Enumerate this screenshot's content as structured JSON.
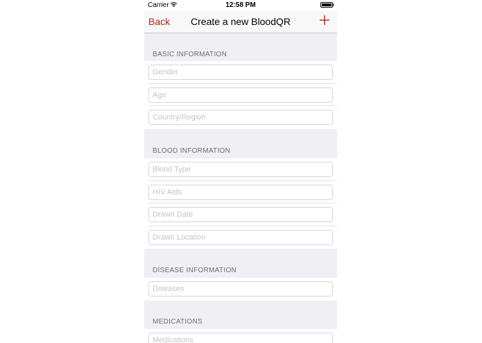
{
  "status_bar": {
    "carrier": "Carrier",
    "time": "12:58 PM"
  },
  "nav": {
    "back_label": "Back",
    "title": "Create a new BloodQR",
    "add_icon": "plus-icon"
  },
  "colors": {
    "accent": "#b4201d",
    "group_background": "#efeff4",
    "section_text": "#6d6d72"
  },
  "sections": {
    "basic": {
      "title": "BASIC INFORMATION",
      "fields": [
        "Gender",
        "Age",
        "Country/Region"
      ]
    },
    "blood": {
      "title": "BLOOD INFORMATION",
      "fields": [
        "Blood Type",
        "HIV Aids",
        "Drawn Date",
        "Drawn Location"
      ]
    },
    "disease": {
      "title": "DISEASE INFORMATION",
      "fields": [
        "Diseases"
      ]
    },
    "medications": {
      "title": "MEDICATIONS",
      "fields": [
        "Medications"
      ]
    }
  }
}
